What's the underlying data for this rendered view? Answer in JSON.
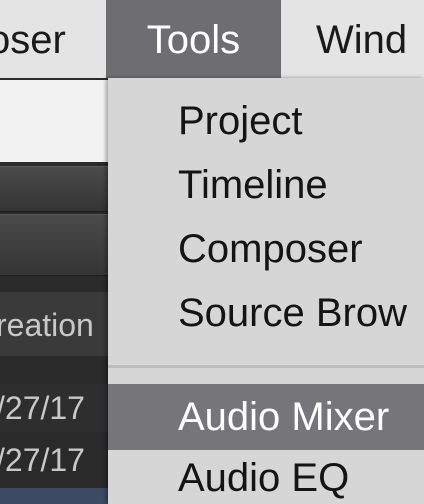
{
  "menubar": {
    "left_partial_label": "oser",
    "active_label": "Tools",
    "right_partial_label": "Wind"
  },
  "background_app": {
    "column_header": "reation",
    "rows": [
      "/27/17",
      "/27/17"
    ]
  },
  "tools_menu": {
    "items": [
      {
        "label": "Project"
      },
      {
        "label": "Timeline"
      },
      {
        "label": "Composer"
      },
      {
        "label": "Source Brow"
      },
      {
        "label": "Audio Mixer"
      },
      {
        "label": "Audio EQ"
      }
    ],
    "highlighted_index": 4
  },
  "colors": {
    "menubar_bg": "#e4e4e4",
    "active_menu_bg": "#6e6e70",
    "dropdown_bg": "#d6d6d6",
    "highlight_bg": "#75757a",
    "app_bg": "#2a2a2a"
  }
}
